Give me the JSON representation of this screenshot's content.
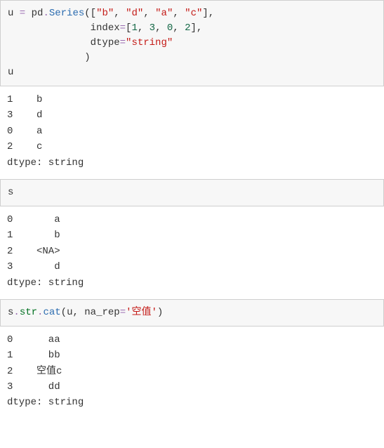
{
  "cell1": {
    "code": {
      "l1": {
        "u": "u",
        "eq": " = ",
        "pd": "pd",
        "dot": ".",
        "ser": "Series",
        "op": "([",
        "s1": "\"b\"",
        "c1": ", ",
        "s2": "\"d\"",
        "c2": ", ",
        "s3": "\"a\"",
        "c3": ", ",
        "s4": "\"c\"",
        "cl": "],"
      },
      "l2": {
        "indent": "              ",
        "key": "index",
        "eq": "=",
        "op": "[",
        "n1": "1",
        "c1": ", ",
        "n2": "3",
        "c2": ", ",
        "n3": "0",
        "c3": ", ",
        "n4": "2",
        "cl": "],"
      },
      "l3": {
        "indent": "              ",
        "key": "dtype",
        "eq": "=",
        "val": "\"string\""
      },
      "l4": {
        "indent": "             ",
        "close": ")"
      },
      "l5": {
        "u": "u"
      }
    },
    "output": "1    b\n3    d\n0    a\n2    c\ndtype: string"
  },
  "cell2": {
    "code": {
      "s": "s"
    },
    "output": "0       a\n1       b\n2    <NA>\n3       d\ndtype: string"
  },
  "cell3": {
    "code": {
      "s": "s",
      "dot1": ".",
      "str": "str",
      "dot2": ".",
      "cat": "cat",
      "op": "(",
      "u": "u",
      "c": ", ",
      "key": "na_rep",
      "eq": "=",
      "val": "'空值'",
      "cl": ")"
    },
    "output": "0      aa\n1      bb\n2    空值c\n3      dd\ndtype: string"
  },
  "chart_data": {
    "type": "table",
    "cells": [
      {
        "code": "u = pd.Series([\"b\", \"d\", \"a\", \"c\"],\n              index=[1, 3, 0, 2],\n              dtype=\"string\"\n             )\nu",
        "series": {
          "index": [
            1,
            3,
            0,
            2
          ],
          "values": [
            "b",
            "d",
            "a",
            "c"
          ],
          "dtype": "string"
        }
      },
      {
        "code": "s",
        "series": {
          "index": [
            0,
            1,
            2,
            3
          ],
          "values": [
            "a",
            "b",
            "<NA>",
            "d"
          ],
          "dtype": "string"
        }
      },
      {
        "code": "s.str.cat(u, na_rep='空值')",
        "series": {
          "index": [
            0,
            1,
            2,
            3
          ],
          "values": [
            "aa",
            "bb",
            "空值c",
            "dd"
          ],
          "dtype": "string"
        }
      }
    ]
  }
}
